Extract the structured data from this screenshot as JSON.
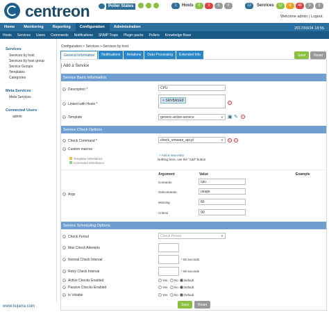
{
  "header": {
    "logo_text": "centreon",
    "poller_states": "Poller States",
    "hosts_label": "Hosts",
    "hosts_count": "1",
    "host_counts": [
      "0",
      "0",
      "0",
      "0"
    ],
    "services_label": "Services",
    "services_count": "12",
    "service_counts": [
      "12",
      "0",
      "46",
      "0",
      "0"
    ],
    "welcome": "Welcome admin | Logout",
    "time": "2017/03/24 18:55"
  },
  "nav": [
    "Home",
    "Monitoring",
    "Reporting",
    "Configuration",
    "Administration"
  ],
  "subnav": [
    "Hosts",
    "Services",
    "Users",
    "Commands",
    "Notifications",
    "SNMP Traps",
    "Plugin packs",
    "Pollers",
    "Knowledge Base"
  ],
  "sidebar": {
    "services_title": "Services",
    "services_items": [
      "Services by host",
      "Services by host group",
      "Service Groups",
      "Templates",
      "Categories"
    ],
    "meta_title": "Meta Services",
    "meta_items": [
      "Meta Services"
    ],
    "users_title": "Connected Users",
    "users": [
      "admin"
    ]
  },
  "breadcrumb": "Configuration  >  Services  >  Services by host",
  "tabs": [
    "General Information",
    "Notifications",
    "Relations",
    "Data Processing",
    "Extended Info"
  ],
  "buttons": {
    "save": "Save",
    "reset": "Reset"
  },
  "form": {
    "title": "| Add a Service",
    "basic_section": "Service Basic Information",
    "description_label": "Description *",
    "description_value": "CPU",
    "linked_hosts_label": "Linked with Hosts *",
    "linked_host": "SRVBASE8",
    "template_label": "Template",
    "template_value": "generic-active-service",
    "check_section": "Service Check Options",
    "check_command_label": "Check Command *",
    "check_command_value": "check_vmware_api.pl",
    "custom_macros_label": "Custom macros",
    "add_entry": "+ Add a new entry",
    "no_entry": "Nothing here, use the \"Add\" button",
    "template_inheritance": "Template inheritance",
    "command_inheritance": "Command inheritance",
    "args_label": "Args",
    "args_headers": [
      "Argument",
      "Value",
      "Example"
    ],
    "args": [
      {
        "name": "Comando",
        "value": "cpu"
      },
      {
        "name": "Subcomando",
        "value": "usage"
      },
      {
        "name": "Warning",
        "value": "80"
      },
      {
        "name": "Critical",
        "value": "90"
      }
    ],
    "scheduling_section": "Service Scheduling Options",
    "check_period_label": "Check Period",
    "check_period_value": "Check Period",
    "max_attempts_label": "Max Check Attempts",
    "normal_interval_label": "Normal Check Interval",
    "retry_interval_label": "Retry Check Interval",
    "seconds_suffix": "* 60 seconds",
    "active_label": "Active Checks Enabled",
    "passive_label": "Passive Checks Enabled",
    "volatile_label": "Is Volatile",
    "radio_options": [
      "Yes",
      "No",
      "Default"
    ]
  },
  "watermark": "www.bujarra.com"
}
